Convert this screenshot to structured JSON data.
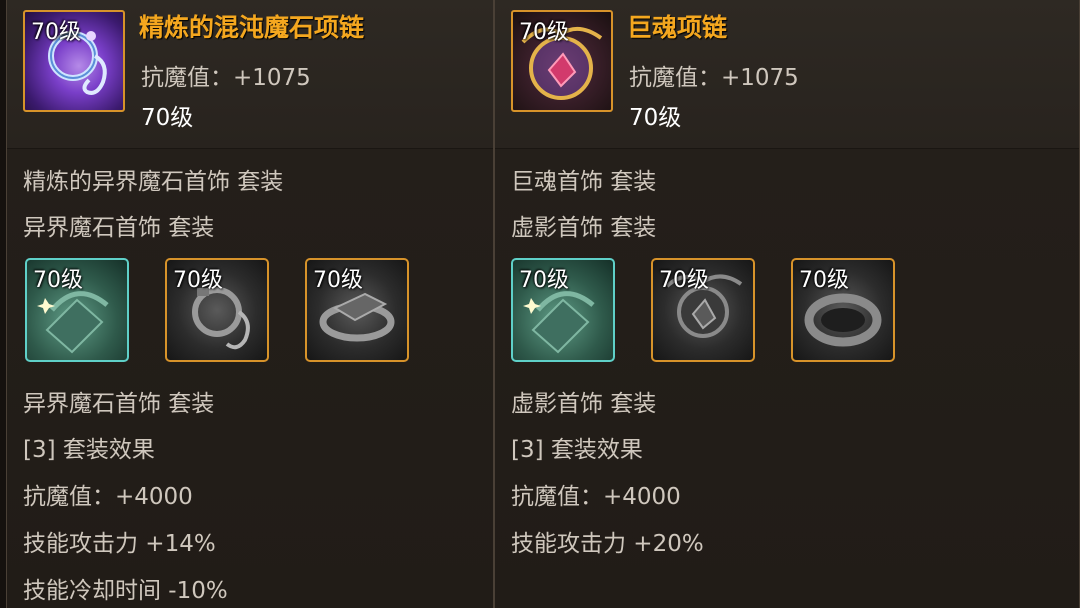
{
  "left": {
    "item": {
      "level_tag": "70级",
      "title": "精炼的混沌魔石项链",
      "stat": "抗魔值：+1075",
      "level": "70级",
      "icon": "chaos-stone-necklace-icon"
    },
    "set_name_1": "精炼的异界魔石首饰  套装",
    "set_name_2": "异界魔石首饰  套装",
    "slots": [
      {
        "level_tag": "70级",
        "icon": "bracelet-icon",
        "rarity_color": "#5fd0c8"
      },
      {
        "level_tag": "70级",
        "icon": "necklace-icon",
        "rarity_color": "#d7932a"
      },
      {
        "level_tag": "70级",
        "icon": "ring-icon",
        "rarity_color": "#d7932a"
      }
    ],
    "set_name_3": "异界魔石首饰  套装",
    "set_effect_title": "[3] 套装效果",
    "effects": [
      "抗魔值：+4000",
      "技能攻击力 +14%",
      "技能冷却时间 -10%"
    ]
  },
  "right": {
    "item": {
      "level_tag": "70级",
      "title": "巨魂项链",
      "stat": "抗魔值：+1075",
      "level": "70级",
      "icon": "giant-soul-necklace-icon"
    },
    "set_name_1": "巨魂首饰  套装",
    "set_name_2": "虚影首饰  套装",
    "slots": [
      {
        "level_tag": "70级",
        "icon": "bracelet-icon",
        "rarity_color": "#5fd0c8"
      },
      {
        "level_tag": "70级",
        "icon": "necklace-icon",
        "rarity_color": "#d7932a"
      },
      {
        "level_tag": "70级",
        "icon": "ring-icon",
        "rarity_color": "#d7932a"
      }
    ],
    "set_name_3": "虚影首饰  套装",
    "set_effect_title": "[3] 套装效果",
    "effects": [
      "抗魔值：+4000",
      "技能攻击力 +20%"
    ]
  },
  "colors": {
    "title": "#f4a71f",
    "text": "#cfc7bd",
    "gold_border": "#d7932a",
    "epic_border": "#5fd0c8"
  }
}
